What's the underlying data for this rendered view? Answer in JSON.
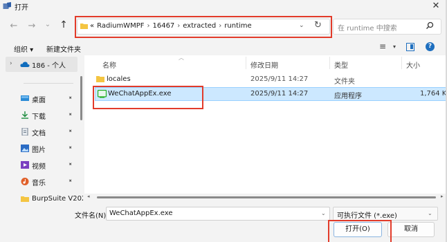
{
  "window": {
    "title": "打开",
    "close_glyph": "✕"
  },
  "nav": {
    "back_glyph": "←",
    "forward_glyph": "→",
    "recent_glyph": "⌄",
    "up_glyph": "↑"
  },
  "address": {
    "overflow": "«",
    "crumbs": [
      "RadiumWMPF",
      "16467",
      "extracted",
      "runtime"
    ],
    "sep": "›",
    "dropdown_glyph": "⌄",
    "refresh_glyph": "↻"
  },
  "search": {
    "placeholder": "在 runtime 中搜索"
  },
  "toolbar": {
    "organize_label": "组织 ▾",
    "new_folder_label": "新建文件夹",
    "view_glyph": "≡",
    "view_drop_glyph": "▾",
    "help_glyph": "?"
  },
  "sidebar": {
    "onedrive_chevron": "›",
    "onedrive_label": "186 - 个人",
    "quick_access": [
      {
        "label": "桌面",
        "icon": "desktop-icon",
        "color": "#2b8bd6"
      },
      {
        "label": "下载",
        "icon": "download-icon",
        "color": "#1a8a3c"
      },
      {
        "label": "文档",
        "icon": "document-icon",
        "color": "#6b7a8a"
      },
      {
        "label": "图片",
        "icon": "pictures-icon",
        "color": "#2b6cc4"
      },
      {
        "label": "视频",
        "icon": "videos-icon",
        "color": "#7a3fc0"
      },
      {
        "label": "音乐",
        "icon": "music-icon",
        "color": "#e0602a"
      }
    ],
    "pin_glyph": "📌",
    "partial_item": "BurpSuite V202"
  },
  "columns": {
    "name": "名称",
    "modified": "修改日期",
    "type": "类型",
    "size": "大小"
  },
  "files": [
    {
      "name": "locales",
      "modified": "2025/9/11 14:27",
      "type": "文件夹",
      "size": "",
      "icon": "folder-icon"
    },
    {
      "name": "WeChatAppEx.exe",
      "modified": "2025/9/11 14:27",
      "type": "应用程序",
      "size": "1,764 K",
      "icon": "exe-icon"
    }
  ],
  "bottom": {
    "filename_label": "文件名(N):",
    "filename_value": "WeChatAppEx.exe",
    "filetype_value": "可执行文件 (*.exe)",
    "open_label": "打开(O)",
    "cancel_label": "取消",
    "drop_glyph": "⌄"
  },
  "colors": {
    "highlight": "#e23b2a",
    "selection": "#cce8ff",
    "accent": "#1e6fbf",
    "folder": "#f4c542"
  }
}
